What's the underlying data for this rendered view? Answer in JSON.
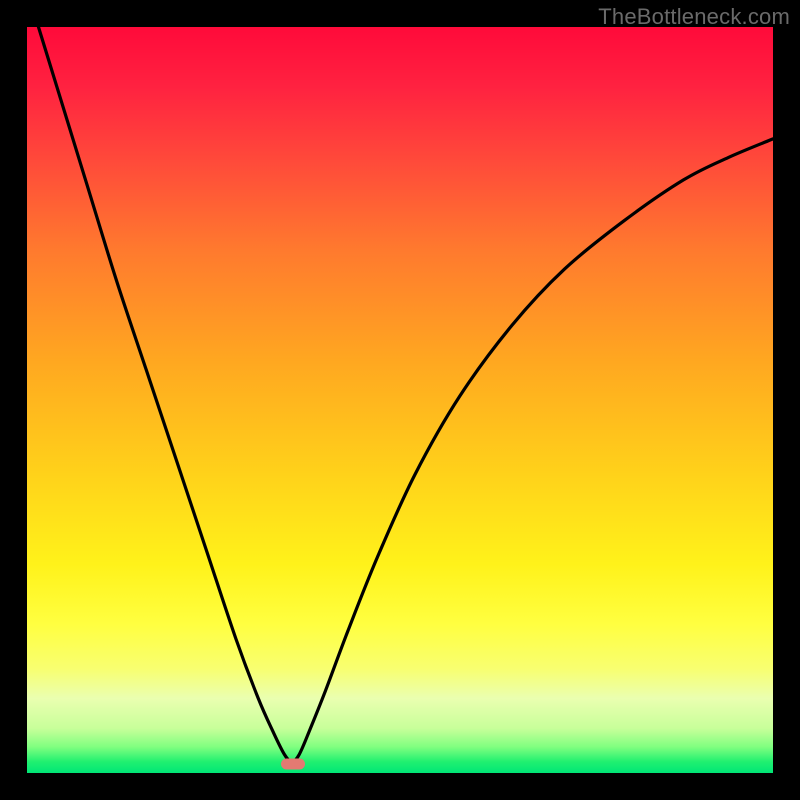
{
  "watermark": "TheBottleneck.com",
  "colors": {
    "frame_bg": "#000000",
    "curve": "#000000",
    "marker": "#e37a72",
    "gradient_stops": [
      {
        "offset": 0.0,
        "color": "#ff0a3a"
      },
      {
        "offset": 0.08,
        "color": "#ff2240"
      },
      {
        "offset": 0.18,
        "color": "#ff4a3a"
      },
      {
        "offset": 0.3,
        "color": "#ff7a2e"
      },
      {
        "offset": 0.45,
        "color": "#ffa820"
      },
      {
        "offset": 0.6,
        "color": "#ffd21a"
      },
      {
        "offset": 0.72,
        "color": "#fff21a"
      },
      {
        "offset": 0.8,
        "color": "#ffff40"
      },
      {
        "offset": 0.86,
        "color": "#f8ff70"
      },
      {
        "offset": 0.9,
        "color": "#eaffb0"
      },
      {
        "offset": 0.94,
        "color": "#c8ff9a"
      },
      {
        "offset": 0.965,
        "color": "#80ff80"
      },
      {
        "offset": 0.985,
        "color": "#20f070"
      },
      {
        "offset": 1.0,
        "color": "#00e676"
      }
    ]
  },
  "chart_data": {
    "type": "line",
    "title": "",
    "xlabel": "",
    "ylabel": "",
    "xlim": [
      0,
      1
    ],
    "ylim": [
      0,
      1
    ],
    "notes": "V-shaped bottleneck curve. x is normalized position along horizontal axis; y is normalized bottleneck magnitude (0 at bottom / optimal, 1 at top / worst). Minimum near x≈0.355, y≈0.015.",
    "series": [
      {
        "name": "bottleneck-curve",
        "x": [
          0.0,
          0.04,
          0.08,
          0.12,
          0.16,
          0.2,
          0.24,
          0.28,
          0.31,
          0.33,
          0.345,
          0.355,
          0.365,
          0.38,
          0.4,
          0.43,
          0.47,
          0.52,
          0.58,
          0.65,
          0.72,
          0.8,
          0.88,
          0.94,
          1.0
        ],
        "values": [
          1.05,
          0.92,
          0.79,
          0.66,
          0.54,
          0.42,
          0.3,
          0.18,
          0.1,
          0.055,
          0.025,
          0.015,
          0.025,
          0.06,
          0.11,
          0.19,
          0.29,
          0.4,
          0.505,
          0.6,
          0.675,
          0.74,
          0.795,
          0.825,
          0.85
        ]
      }
    ],
    "marker": {
      "x": 0.357,
      "y": 0.012
    }
  }
}
